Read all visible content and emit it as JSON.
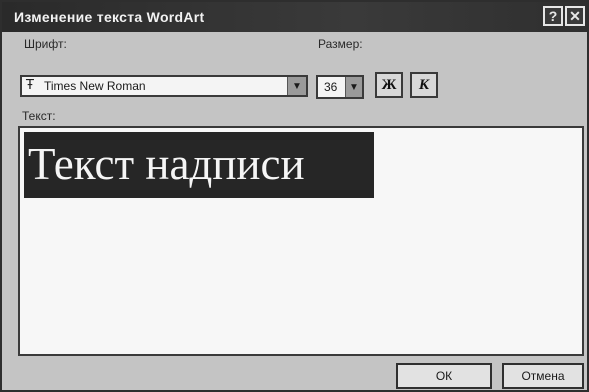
{
  "window": {
    "title": "Изменение текста WordArt",
    "help_label": "?",
    "close_label": "✕"
  },
  "font": {
    "label": "Шрифт:",
    "value": "Times New Roman",
    "icon": "truetype-font-icon"
  },
  "size": {
    "label": "Размер:",
    "value": "36"
  },
  "format": {
    "bold_label": "Ж",
    "italic_label": "К"
  },
  "text": {
    "label": "Текст:",
    "value": "Текст надписи"
  },
  "buttons": {
    "ok_label": "ОК",
    "cancel_label": "Отмена"
  }
}
